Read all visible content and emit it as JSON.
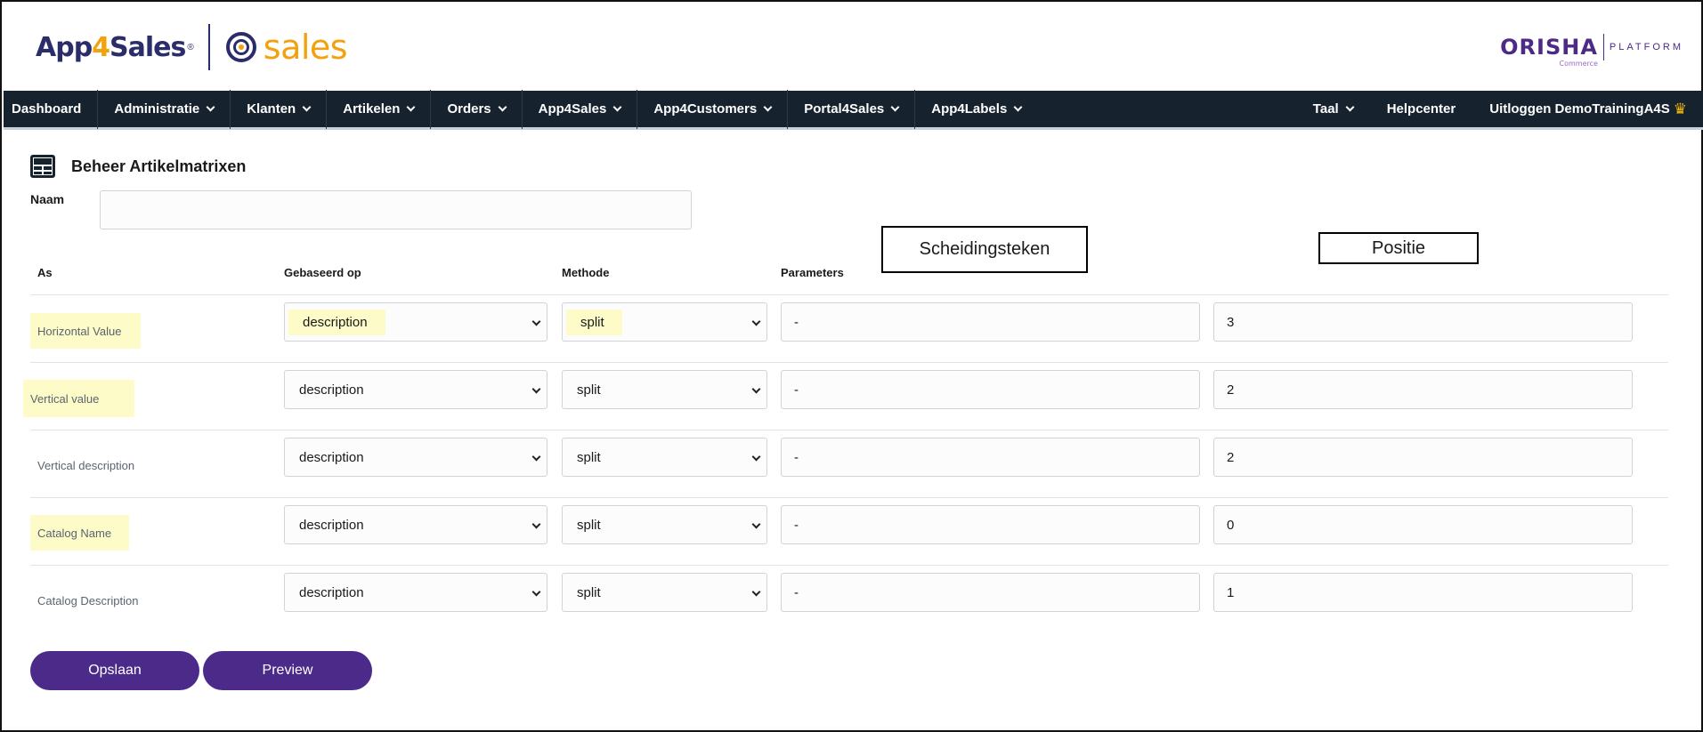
{
  "brand": {
    "app_name_prefix": "App",
    "app_name_four": "4",
    "app_name_suffix": "Sales",
    "registered_mark": "®",
    "product": "sales",
    "partner_name": "ORISHA",
    "partner_sub": "Commerce",
    "partner_platform": "PLATFORM",
    "colors": {
      "navy": "#2b2d6b",
      "orange": "#f2a20c",
      "purple": "#4b2a8a",
      "nav_bg": "#16222d"
    }
  },
  "nav": {
    "items": [
      {
        "label": "Dashboard",
        "has_dropdown": false
      },
      {
        "label": "Administratie",
        "has_dropdown": true
      },
      {
        "label": "Klanten",
        "has_dropdown": true
      },
      {
        "label": "Artikelen",
        "has_dropdown": true
      },
      {
        "label": "Orders",
        "has_dropdown": true
      },
      {
        "label": "App4Sales",
        "has_dropdown": true
      },
      {
        "label": "App4Customers",
        "has_dropdown": true
      },
      {
        "label": "Portal4Sales",
        "has_dropdown": true
      },
      {
        "label": "App4Labels",
        "has_dropdown": true
      }
    ],
    "right": {
      "language": "Taal",
      "help": "Helpcenter",
      "logout": "Uitloggen DemoTrainingA4S",
      "crown_icon": "crown-icon"
    }
  },
  "page": {
    "title": "Beheer Artikelmatrixen",
    "title_icon": "table-grid-icon",
    "naam_label": "Naam",
    "naam_value": ""
  },
  "callouts": {
    "separator": "Scheidingsteken",
    "position": "Positie"
  },
  "table": {
    "headers": {
      "as": "As",
      "based_on": "Gebaseerd op",
      "method": "Methode",
      "parameters": "Parameters"
    },
    "rows": [
      {
        "label": "Horizontal Value",
        "based_on": "description",
        "method": "split",
        "separator": "-",
        "position": "3",
        "label_highlight": true,
        "based_on_highlight": true,
        "method_highlight": true
      },
      {
        "label": "Vertical value",
        "based_on": "description",
        "method": "split",
        "separator": "-",
        "position": "2",
        "label_highlight": true,
        "based_on_highlight": false,
        "method_highlight": false
      },
      {
        "label": "Vertical description",
        "based_on": "description",
        "method": "split",
        "separator": "-",
        "position": "2",
        "label_highlight": false,
        "based_on_highlight": false,
        "method_highlight": false
      },
      {
        "label": "Catalog Name",
        "based_on": "description",
        "method": "split",
        "separator": "-",
        "position": "0",
        "label_highlight": true,
        "based_on_highlight": false,
        "method_highlight": false
      },
      {
        "label": "Catalog Description",
        "based_on": "description",
        "method": "split",
        "separator": "-",
        "position": "1",
        "label_highlight": false,
        "based_on_highlight": false,
        "method_highlight": false
      }
    ]
  },
  "actions": {
    "save": "Opslaan",
    "preview": "Preview"
  }
}
